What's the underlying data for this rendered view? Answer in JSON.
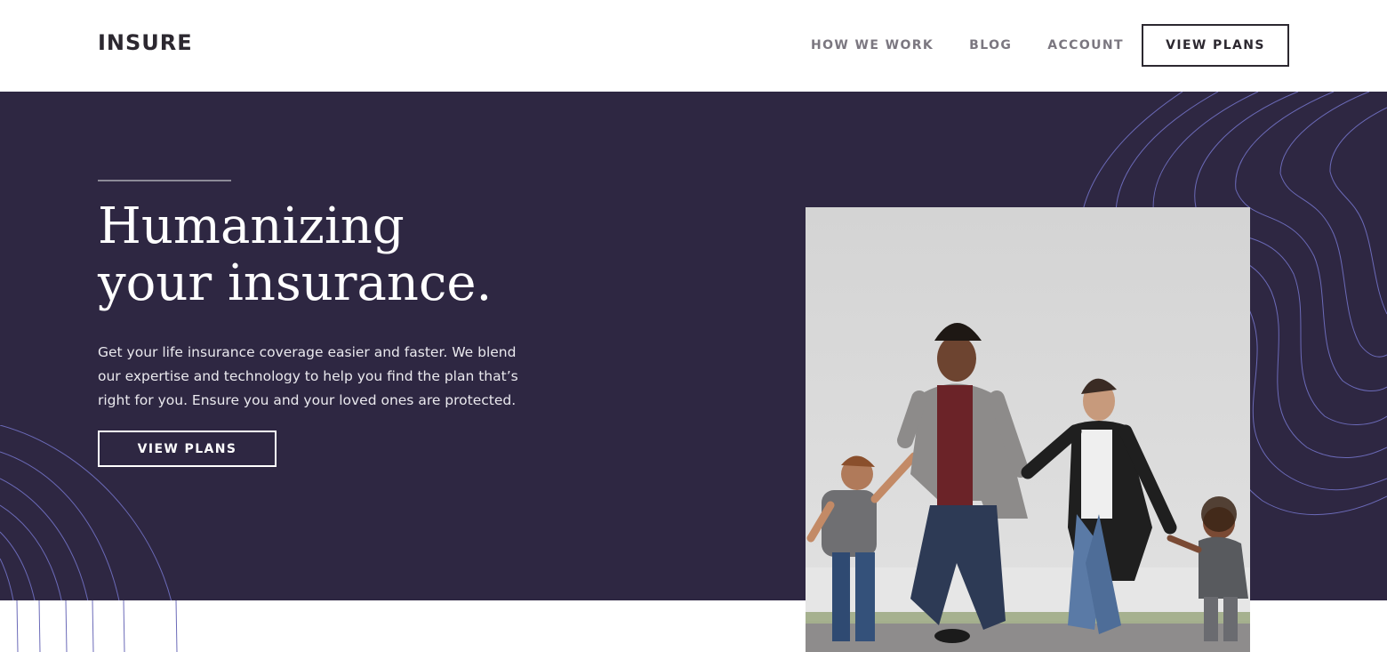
{
  "header": {
    "logo": "INSURE",
    "nav": [
      {
        "label": "HOW WE WORK"
      },
      {
        "label": "BLOG"
      },
      {
        "label": "ACCOUNT"
      }
    ],
    "cta_label": "VIEW PLANS"
  },
  "hero": {
    "title_line1": "Humanizing",
    "title_line2": "your insurance.",
    "description": "Get your life insurance coverage easier and faster. We blend our expertise and technology to help you find the plan that’s right for you. Ensure you and your loved ones are protected.",
    "cta_label": "VIEW PLANS"
  },
  "colors": {
    "hero_bg": "#2e2742",
    "text_dark": "#2c2830",
    "nav_text": "#7b7780",
    "pattern_line": "#6b6ab8"
  },
  "icons": {
    "logo": "insure-wordmark",
    "hero_image": "family-photo",
    "patterns": [
      "contour-lines-right",
      "concentric-arcs-left"
    ]
  }
}
